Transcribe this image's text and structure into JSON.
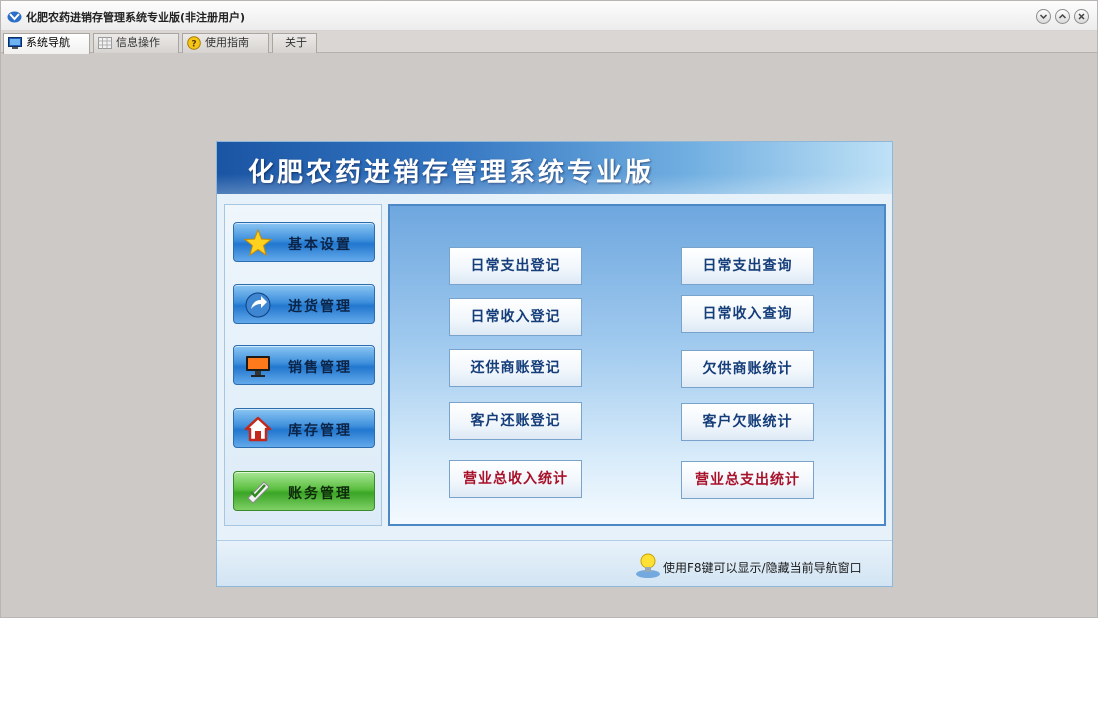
{
  "window": {
    "title": "化肥农药进销存管理系统专业版(非注册用户)",
    "controls": [
      "minimize",
      "maximize",
      "close"
    ]
  },
  "tabs": [
    {
      "label": "系统导航",
      "icon": "monitor-icon",
      "active": true
    },
    {
      "label": "信息操作",
      "icon": "grid-icon",
      "active": false
    },
    {
      "label": "使用指南",
      "icon": "help-icon",
      "active": false
    },
    {
      "label": "关于",
      "icon": "",
      "active": false
    }
  ],
  "panel": {
    "title": "化肥农药进销存管理系统专业版",
    "sidebar": [
      {
        "label": "基本设置",
        "icon": "star-icon"
      },
      {
        "label": "进货管理",
        "icon": "arrow-icon"
      },
      {
        "label": "销售管理",
        "icon": "monitor-icon"
      },
      {
        "label": "库存管理",
        "icon": "house-icon"
      },
      {
        "label": "账务管理",
        "icon": "checklist-icon",
        "selected": true
      }
    ],
    "actions": [
      {
        "label": "日常支出登记"
      },
      {
        "label": "日常支出查询"
      },
      {
        "label": "日常收入登记"
      },
      {
        "label": "日常收入查询"
      },
      {
        "label": "还供商账登记"
      },
      {
        "label": "欠供商账统计"
      },
      {
        "label": "客户还账登记"
      },
      {
        "label": "客户欠账统计"
      },
      {
        "label": "营业总收入统计",
        "emphasis": true
      },
      {
        "label": "营业总支出统计",
        "emphasis": true
      }
    ],
    "footer_hint": "使用F8键可以显示/隐藏当前导航窗口"
  },
  "colors": {
    "accent_blue": "#2277cf",
    "accent_green": "#3ba526",
    "emphasis_red": "#a8112a",
    "action_text": "#143d7a"
  }
}
